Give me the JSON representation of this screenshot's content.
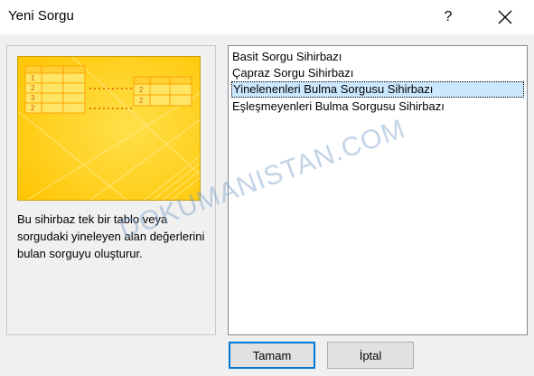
{
  "window": {
    "title": "Yeni Sorgu",
    "help_label": "?"
  },
  "preview": {
    "left_rows": [
      "1",
      "2",
      "3",
      "2"
    ],
    "right_rows": [
      "2",
      "2"
    ],
    "colors": {
      "bg": "#ffd21a",
      "grid": "#ffa500",
      "cell": "#ffe566"
    }
  },
  "description": "Bu sihirbaz tek bir tablo veya sorgudaki yineleyen alan değerlerini bulan sorguyu oluşturur.",
  "list": {
    "items": [
      "Basit Sorgu Sihirbazı",
      "Çapraz Sorgu Sihirbazı",
      "Yinelenenleri Bulma Sorgusu Sihirbazı",
      "Eşleşmeyenleri Bulma Sorgusu Sihirbazı"
    ],
    "selected_index": 2
  },
  "watermark": "DOKUMANISTAN.COM",
  "buttons": {
    "ok": "Tamam",
    "cancel": "İptal"
  }
}
